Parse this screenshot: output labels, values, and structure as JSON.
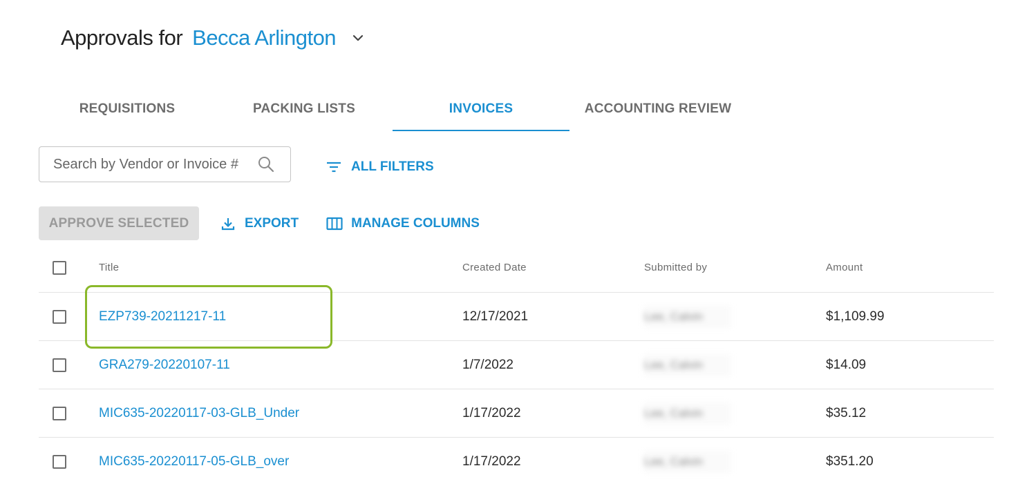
{
  "header": {
    "prefix": "Approvals for",
    "user_name": "Becca Arlington",
    "dropdown_icon": "chevron-down-icon"
  },
  "tabs": [
    {
      "label": "REQUISITIONS",
      "active": false
    },
    {
      "label": "PACKING LISTS",
      "active": false
    },
    {
      "label": "INVOICES",
      "active": true
    },
    {
      "label": "ACCOUNTING REVIEW",
      "active": false
    }
  ],
  "search": {
    "placeholder": "Search by Vendor or Invoice #",
    "value": "",
    "icon": "search-icon"
  },
  "filters": {
    "label": "ALL FILTERS",
    "icon": "filter-icon"
  },
  "toolbar": {
    "approve_label": "APPROVE SELECTED",
    "export_label": "EXPORT",
    "export_icon": "download-icon",
    "columns_label": "MANAGE COLUMNS",
    "columns_icon": "columns-icon"
  },
  "table": {
    "columns": [
      "Title",
      "Created Date",
      "Submitted by",
      "Amount"
    ],
    "rows": [
      {
        "title": "EZP739-20211217-11",
        "created": "12/17/2021",
        "submitted_by": "Lee, Calvin",
        "amount": "$1,109.99"
      },
      {
        "title": "GRA279-20220107-11",
        "created": "1/7/2022",
        "submitted_by": "Lee, Calvin",
        "amount": "$14.09"
      },
      {
        "title": "MIC635-20220117-03-GLB_Under",
        "created": "1/17/2022",
        "submitted_by": "Lee, Calvin",
        "amount": "$35.12"
      },
      {
        "title": "MIC635-20220117-05-GLB_over",
        "created": "1/17/2022",
        "submitted_by": "Lee, Calvin",
        "amount": "$351.20"
      }
    ]
  },
  "colors": {
    "accent": "#1a8fd1",
    "highlight": "#8ab82a",
    "disabled_bg": "#e0e0e0"
  }
}
